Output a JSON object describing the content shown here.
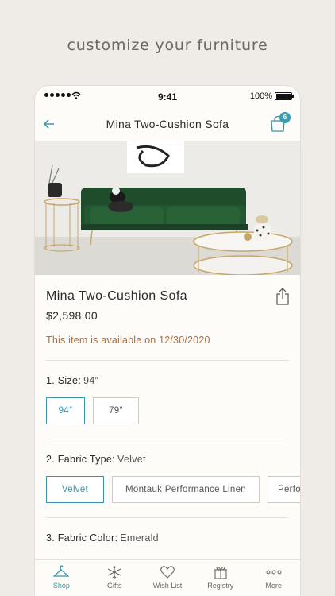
{
  "headline": "customize your furniture",
  "status": {
    "time": "9:41",
    "battery": "100%"
  },
  "nav": {
    "title": "Mina Two-Cushion Sofa",
    "cart_count": "6"
  },
  "product": {
    "name": "Mina Two-Cushion Sofa",
    "price": "$2,598.00",
    "availability": "This item is available on 12/30/2020"
  },
  "size": {
    "label": "1. Size:",
    "selected": "94″",
    "options": [
      "94″",
      "79″"
    ]
  },
  "fabric_type": {
    "label": "2. Fabric Type:",
    "selected": "Velvet",
    "options": [
      "Velvet",
      "Montauk Performance Linen",
      "Perfo"
    ]
  },
  "fabric_color": {
    "label": "3. Fabric Color:",
    "selected": "Emerald"
  },
  "tabs": [
    {
      "label": "Shop",
      "icon": "hanger-icon"
    },
    {
      "label": "Gifts",
      "icon": "snowflake-icon"
    },
    {
      "label": "Wish List",
      "icon": "heart-icon"
    },
    {
      "label": "Registry",
      "icon": "gift-icon"
    },
    {
      "label": "More",
      "icon": "more-icon"
    }
  ],
  "colors": {
    "accent": "#3b93a8",
    "availability": "#b46a3a",
    "sofa": "#1f4d2c",
    "background": "#efebe6"
  }
}
